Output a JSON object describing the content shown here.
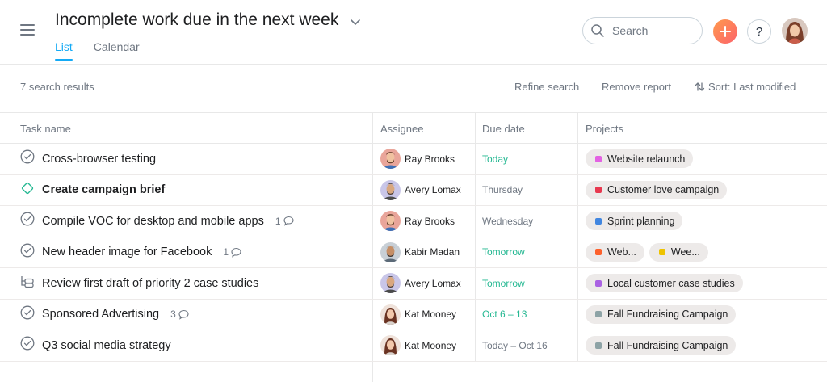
{
  "header": {
    "title": "Incomplete work due in the next week",
    "tabs": [
      {
        "label": "List",
        "active": true
      },
      {
        "label": "Calendar",
        "active": false
      }
    ],
    "search_label": "Search",
    "help_label": "?"
  },
  "toolbar": {
    "results_count": "7 search results",
    "refine_label": "Refine search",
    "remove_label": "Remove report",
    "sort_label": "Sort: Last modified"
  },
  "columns": {
    "task": "Task name",
    "assignee": "Assignee",
    "due": "Due date",
    "projects": "Projects"
  },
  "colors": {
    "accent": "#14aaf5",
    "due_green": "#25b892",
    "due_gray": "#6f7782"
  },
  "rows": [
    {
      "icon": "check-circle-icon",
      "name": "Cross-browser testing",
      "bold": false,
      "comments": "",
      "assignee": "Ray Brooks",
      "avatar": "ray",
      "due": "Today",
      "due_color": "#25b892",
      "projects": [
        {
          "label": "Website relaunch",
          "color": "#e362e3"
        }
      ]
    },
    {
      "icon": "milestone-diamond-icon",
      "name": "Create campaign brief",
      "bold": true,
      "comments": "",
      "assignee": "Avery Lomax",
      "avatar": "avery",
      "due": "Thursday",
      "due_color": "#6f7782",
      "projects": [
        {
          "label": "Customer love campaign",
          "color": "#e8384f"
        }
      ]
    },
    {
      "icon": "check-circle-icon",
      "name": "Compile VOC for desktop and mobile apps",
      "bold": false,
      "comments": "1",
      "assignee": "Ray Brooks",
      "avatar": "ray",
      "due": "Wednesday",
      "due_color": "#6f7782",
      "projects": [
        {
          "label": "Sprint planning",
          "color": "#4186e0"
        }
      ]
    },
    {
      "icon": "check-circle-icon",
      "name": "New header image for Facebook",
      "bold": false,
      "comments": "1",
      "assignee": "Kabir Madan",
      "avatar": "kabir",
      "due": "Tomorrow",
      "due_color": "#25b892",
      "projects": [
        {
          "label": "Web...",
          "color": "#fd612c"
        },
        {
          "label": "Wee...",
          "color": "#eec300"
        }
      ]
    },
    {
      "icon": "subtask-icon",
      "name": "Review first draft of priority 2 case studies",
      "bold": false,
      "comments": "",
      "assignee": "Avery Lomax",
      "avatar": "avery",
      "due": "Tomorrow",
      "due_color": "#25b892",
      "projects": [
        {
          "label": "Local customer case studies",
          "color": "#aa62e3"
        }
      ]
    },
    {
      "icon": "check-circle-icon",
      "name": "Sponsored Advertising",
      "bold": false,
      "comments": "3",
      "assignee": "Kat Mooney",
      "avatar": "kat",
      "due": "Oct 6 – 13",
      "due_color": "#25b892",
      "projects": [
        {
          "label": "Fall Fundraising Campaign",
          "color": "#8da3a6"
        }
      ]
    },
    {
      "icon": "check-circle-icon",
      "name": "Q3 social media strategy",
      "bold": false,
      "comments": "",
      "assignee": "Kat Mooney",
      "avatar": "kat",
      "due": "Today – Oct 16",
      "due_color": "#6f7782",
      "projects": [
        {
          "label": "Fall Fundraising Campaign",
          "color": "#8da3a6"
        }
      ]
    }
  ]
}
